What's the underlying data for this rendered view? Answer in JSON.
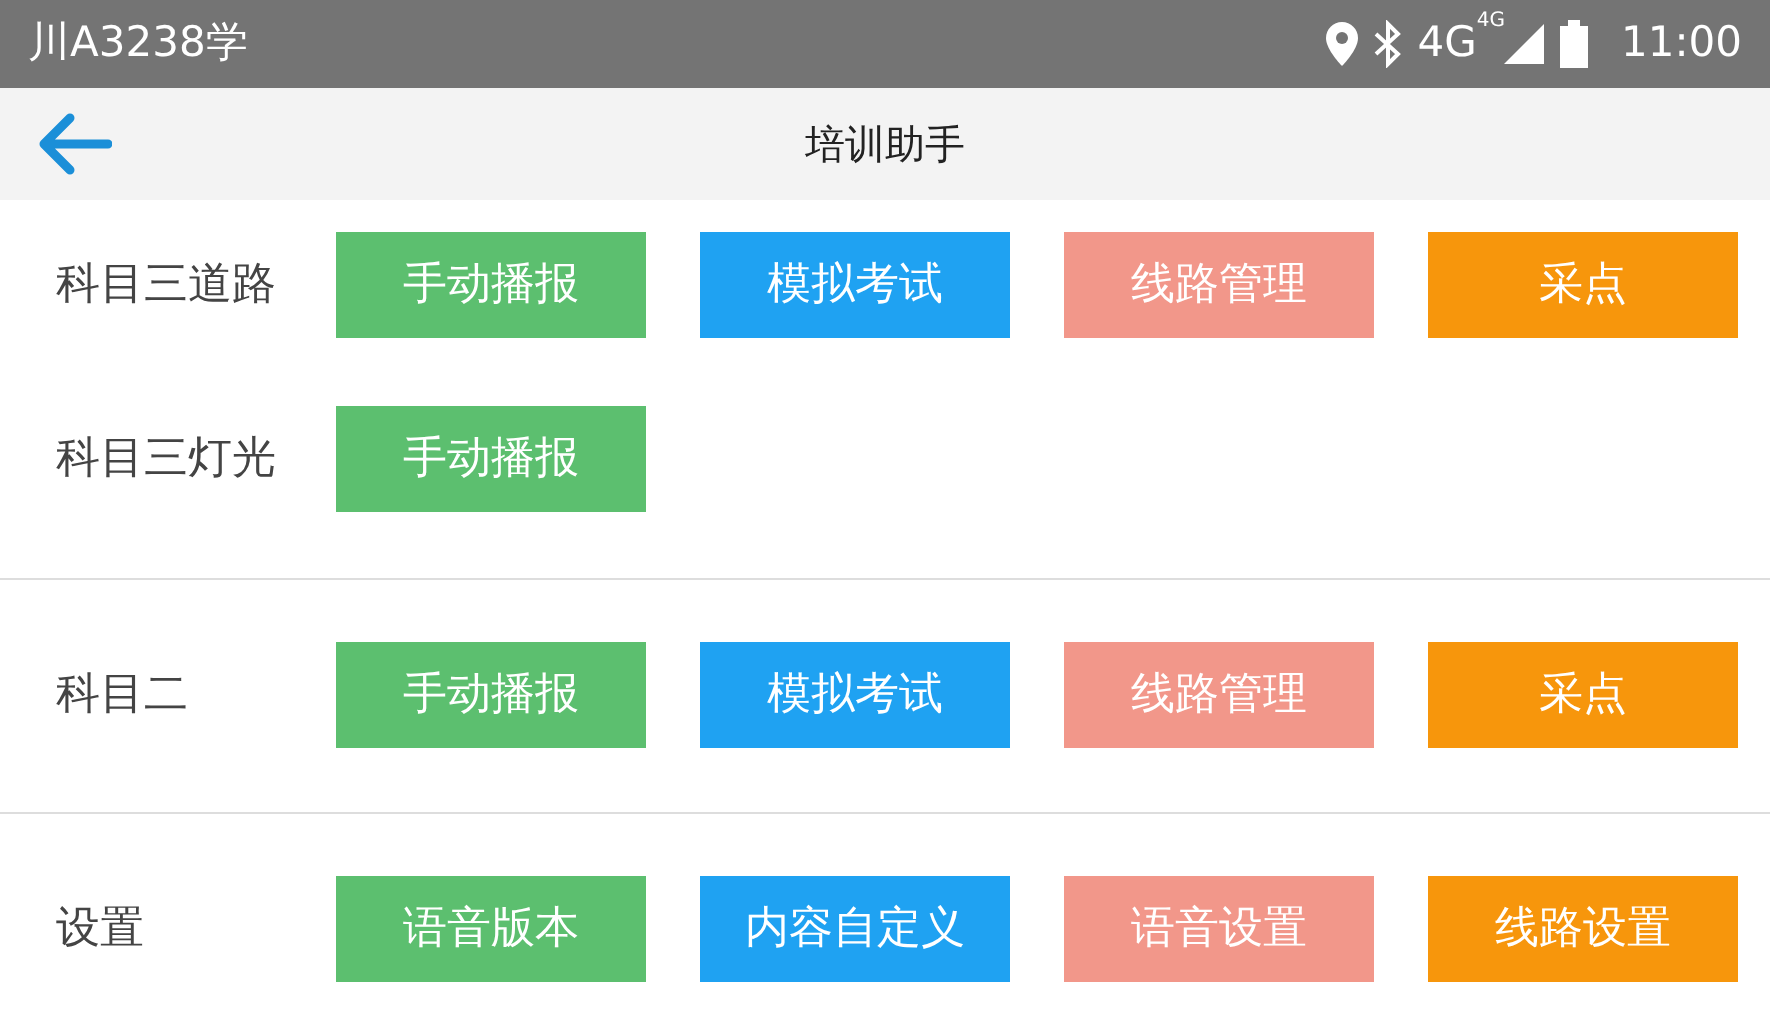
{
  "status_bar": {
    "carrier": "川A3238学",
    "network": "4G",
    "network_sub": "4G",
    "time": "11:00"
  },
  "header": {
    "title": "培训助手"
  },
  "sections": [
    {
      "rows": [
        {
          "label": "科目三道路",
          "buttons": [
            {
              "text": "手动播报",
              "color": "#5cbf6f"
            },
            {
              "text": "模拟考试",
              "color": "#1fa2f2"
            },
            {
              "text": "线路管理",
              "color": "#f2978a"
            },
            {
              "text": "采点",
              "color": "#f7960c"
            }
          ]
        },
        {
          "label": "科目三灯光",
          "buttons": [
            {
              "text": "手动播报",
              "color": "#5cbf6f"
            }
          ]
        }
      ]
    },
    {
      "rows": [
        {
          "label": "科目二",
          "buttons": [
            {
              "text": "手动播报",
              "color": "#5cbf6f"
            },
            {
              "text": "模拟考试",
              "color": "#1fa2f2"
            },
            {
              "text": "线路管理",
              "color": "#f2978a"
            },
            {
              "text": "采点",
              "color": "#f7960c"
            }
          ]
        }
      ]
    },
    {
      "rows": [
        {
          "label": "设置",
          "buttons": [
            {
              "text": "语音版本",
              "color": "#5cbf6f"
            },
            {
              "text": "内容自定义",
              "color": "#1fa2f2"
            },
            {
              "text": "语音设置",
              "color": "#f2978a"
            },
            {
              "text": "线路设置",
              "color": "#f7960c"
            }
          ]
        }
      ]
    }
  ]
}
